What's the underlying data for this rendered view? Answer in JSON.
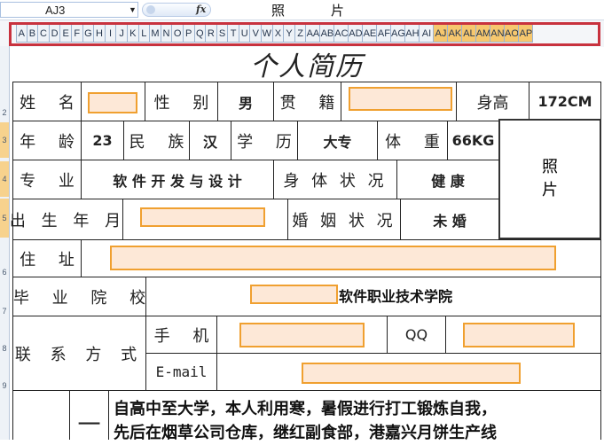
{
  "formula_bar": {
    "name_box": "AJ3",
    "fx_label": "fx",
    "content": "照片"
  },
  "columns": [
    "A",
    "B",
    "C",
    "D",
    "E",
    "F",
    "G",
    "H",
    "I",
    "J",
    "K",
    "L",
    "M",
    "N",
    "O",
    "P",
    "Q",
    "R",
    "S",
    "T",
    "U",
    "V",
    "W",
    "X",
    "Y",
    "Z",
    "AA",
    "AB",
    "AC",
    "AD",
    "AE",
    "AF",
    "AG",
    "AH",
    "AI",
    "AJ",
    "AK",
    "AL",
    "AM",
    "AN",
    "AO",
    "AP"
  ],
  "selected_columns": [
    "AJ",
    "AK",
    "AL",
    "AM",
    "AN",
    "AO",
    "AP"
  ],
  "rows": [
    "2",
    "3",
    "4",
    "5",
    "6",
    "7",
    "8",
    "9"
  ],
  "resume": {
    "title": "个人简历",
    "name_label": "姓 名",
    "gender_label": "性 别",
    "gender_value": "男",
    "native_label": "贯 籍",
    "height_label": "身高",
    "height_value": "172CM",
    "age_label": "年 龄",
    "age_value": "23",
    "ethnic_label": "民 族",
    "ethnic_value": "汉",
    "edu_label": "学 历",
    "edu_value": "大专",
    "weight_label": "体 重",
    "weight_value": "66KG",
    "photo_label": "照\n片",
    "major_label": "专 业",
    "major_value": "软 件 开 发 与 设 计",
    "health_label": "身 体 状 况",
    "health_value": "健 康",
    "birth_label": "出 生 年 月",
    "marital_label": "婚 姻 状 况",
    "marital_value": "未 婚",
    "address_label": "住 址",
    "school_label": "毕 业 院 校",
    "school_value": "软件职业技术学院",
    "contact_label": "联 系 方 式",
    "phone_label": "手 机",
    "qq_label": "QQ",
    "email_label": "E-mail",
    "section_mark": "一",
    "experience_line1": "自高中至大学，本人利用寒，暑假进行打工锻炼自我，",
    "experience_line2": "先后在烟草公司仓库，继红副食部，港嘉兴月饼生产线"
  }
}
